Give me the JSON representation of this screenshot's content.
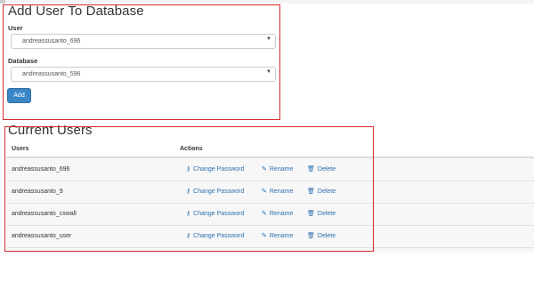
{
  "add_user": {
    "title": "Add User To Database",
    "user_label": "User",
    "user_value": "andreassusanto_696",
    "database_label": "Database",
    "database_value": "andreassusanto_596",
    "add_button": "Add"
  },
  "current_users": {
    "title": "Current Users",
    "columns": [
      "Users",
      "Actions"
    ],
    "rows": [
      {
        "user": "andreassusanto_696"
      },
      {
        "user": "andreassusanto_9"
      },
      {
        "user": "andreassusanto_cxwall"
      },
      {
        "user": "andreassusanto_user"
      }
    ],
    "actions": {
      "change_password": "Change Password",
      "rename": "Rename",
      "delete": "Delete"
    }
  },
  "icons": {
    "select_caret": "caret-down-icon",
    "change_password": "key-icon",
    "rename": "pencil-icon",
    "delete": "trash-icon"
  },
  "colors": {
    "highlight_border": "#d72b2b",
    "link": "#2a70b0",
    "button": "#3b86c6"
  }
}
